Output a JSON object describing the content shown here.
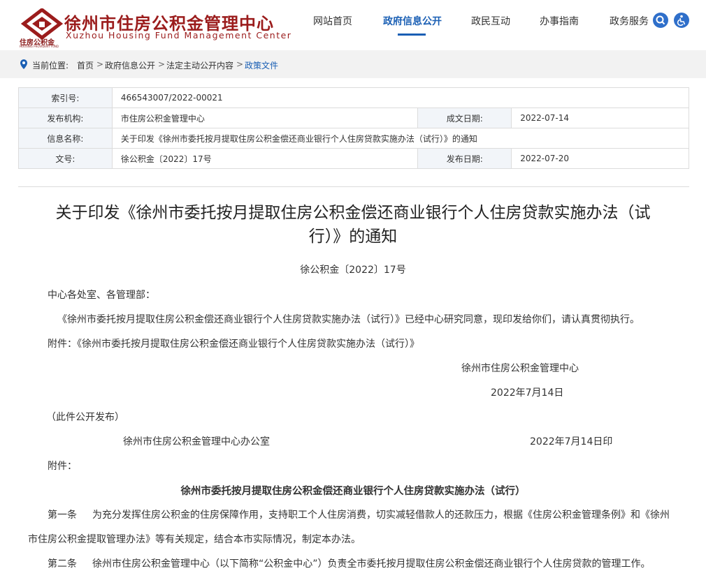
{
  "site": {
    "title": "徐州市住房公积金管理中心",
    "english_title": "Xuzhou Housing Fund Management Center",
    "logo_caption": "住房公积金",
    "logo_tiny": "HOUSING PROVIDENT FUND"
  },
  "nav": {
    "items": [
      "网站首页",
      "政府信息公开",
      "政民互动",
      "办事指南",
      "政务服务"
    ],
    "active_index": 1
  },
  "icons": {
    "search": "search-icon",
    "accessibility": "accessibility-icon",
    "location": "location-pin-icon"
  },
  "colors": {
    "brand_red": "#9b1c1c",
    "accent_blue": "#1a5fb4",
    "label_bg": "#f2f5f9"
  },
  "breadcrumb": {
    "prefix": "当前位置:",
    "items": [
      "首页",
      "政府信息公开",
      "法定主动公开内容",
      "政策文件"
    ]
  },
  "info": {
    "index_label": "索引号:",
    "index_value": "466543007/2022-00021",
    "org_label": "发布机构:",
    "org_value": "市住房公积金管理中心",
    "created_label": "成文日期:",
    "created_value": "2022-07-14",
    "name_label": "信息名称:",
    "name_value": "关于印发《徐州市委托按月提取住房公积金偿还商业银行个人住房贷款实施办法（试行）》的通知",
    "docno_label": "文号:",
    "docno_value": "徐公积金〔2022〕17号",
    "published_label": "发布日期:",
    "published_value": "2022-07-20"
  },
  "article": {
    "title_line1": "关于印发《徐州市委托按月提取住房公积金偿还商业银行个人住房贷款实施办法（试",
    "title_line2": "行）》的通知",
    "docno": "徐公积金〔2022〕17号",
    "recipients": "中心各处室、各管理部：",
    "body1": "《徐州市委托按月提取住房公积金偿还商业银行个人住房贷款实施办法（试行）》已经中心研究同意，现印发给你们，请认真贯彻执行。",
    "attachment": "附件：《徐州市委托按月提取住房公积金偿还商业银行个人住房贷款实施办法（试行）》",
    "sign_org": "徐州市住房公积金管理中心",
    "sign_date": "2022年7月14日",
    "public_note": "（此件公开发布）",
    "office": "徐州市住房公积金管理中心办公室",
    "print_date": "2022年7月14日印",
    "attach_label": "附件：",
    "attach_title": "徐州市委托按月提取住房公积金偿还商业银行个人住房贷款实施办法（试行）",
    "art1_label": "第一条",
    "art1_text": "为充分发挥住房公积金的住房保障作用，支持职工个人住房消费，切实减轻借款人的还款压力，根据《住房公积金管理条例》和《徐州",
    "art1_cont": "市住房公积金提取管理办法》等有关规定，结合本市实际情况，制定本办法。",
    "art2_label": "第二条",
    "art2_text": "徐州市住房公积金管理中心（以下简称“公积金中心”）负责全市委托按月提取住房公积金偿还商业银行个人住房贷款的管理工作。"
  }
}
